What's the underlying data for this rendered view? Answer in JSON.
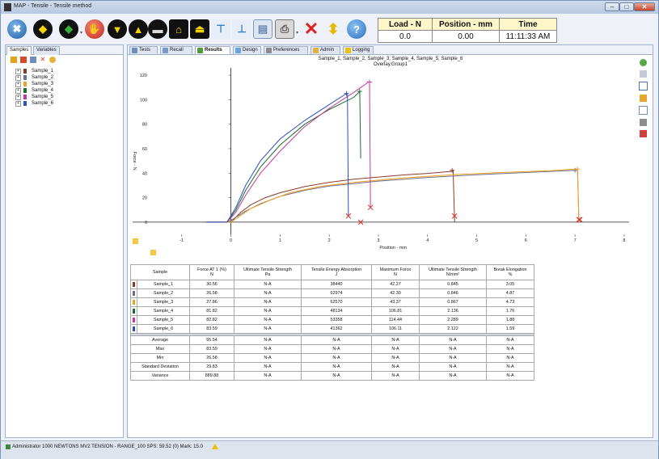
{
  "window": {
    "title": "MAP - Tensile - Tensile method"
  },
  "toolbar": {
    "icons": [
      "tools-icon",
      "sequence-up-icon",
      "sequence-down-icon",
      "stop-icon",
      "jog-down-icon",
      "jog-up-icon",
      "crosshead-icon",
      "home-icon",
      "return-icon",
      "clamp-icon",
      "fixture-icon",
      "report-icon",
      "print-icon",
      "delete-icon",
      "export-icon",
      "help-icon"
    ]
  },
  "readouts": {
    "load": {
      "label": "Load - N",
      "value": "0.0"
    },
    "position": {
      "label": "Position - mm",
      "value": "0.00"
    },
    "time": {
      "label": "Time",
      "value": "11:11:33 AM"
    }
  },
  "left_pane": {
    "tabs": [
      "Samples",
      "Variables"
    ],
    "samples": [
      {
        "name": "Sample_1",
        "color": "#8b3a2a"
      },
      {
        "name": "Sample_2",
        "color": "#6e6e8c"
      },
      {
        "name": "Sample_3",
        "color": "#f0a020"
      },
      {
        "name": "Sample_4",
        "color": "#1b6e2e"
      },
      {
        "name": "Sample_5",
        "color": "#c8389c"
      },
      {
        "name": "Sample_6",
        "color": "#2c4fc4"
      }
    ]
  },
  "main_tabs": [
    "Tests",
    "Recall",
    "Results",
    "Design",
    "Preferences",
    "Admin",
    "Logging"
  ],
  "chart_data": {
    "type": "line",
    "title": "Sample_1, Sample_2, Sample_3, Sample_4, Sample_5, Sample_6",
    "subtitle": "Overlay,Group1",
    "xlabel": "Position - mm",
    "ylabel": "Force - N",
    "xlim": [
      -2,
      8.1
    ],
    "ylim": [
      -10,
      126
    ],
    "xticks": [
      -1,
      0,
      1,
      2,
      3,
      4,
      5,
      6,
      7,
      8
    ],
    "yticks": [
      0,
      20,
      40,
      60,
      80,
      100,
      120
    ],
    "grid": false,
    "series": [
      {
        "name": "Sample_1",
        "color": "#8b3a2a",
        "x": [
          -0.55,
          -0.08,
          0.05,
          0.2,
          0.4,
          0.7,
          1.0,
          1.5,
          2.0,
          2.5,
          3.0,
          3.5,
          4.0,
          4.5,
          4.52,
          4.55
        ],
        "y": [
          0,
          0,
          2,
          8,
          14,
          20,
          24,
          29,
          32.5,
          35,
          36.8,
          38.5,
          39.8,
          41.5,
          42.27,
          0
        ],
        "max_marker": [
          4.5,
          42.27
        ],
        "break_marker": [
          4.55,
          5
        ]
      },
      {
        "name": "Sample_2",
        "color": "#6e6e8c",
        "x": [
          -0.55,
          -0.05,
          0.1,
          0.3,
          0.6,
          1.0,
          1.5,
          2.0,
          3.0,
          4.0,
          5.0,
          6.0,
          7.0,
          7.05,
          7.08
        ],
        "y": [
          0,
          0,
          4,
          9,
          15,
          21,
          26,
          29.5,
          33.5,
          36.5,
          38.7,
          40.5,
          42.3,
          42.3,
          0
        ],
        "max_marker": [
          7.0,
          42.3
        ],
        "break_marker": [
          7.1,
          2
        ]
      },
      {
        "name": "Sample_3",
        "color": "#f0a020",
        "x": [
          -0.5,
          0.0,
          0.15,
          0.4,
          0.8,
          1.2,
          1.8,
          2.5,
          3.5,
          4.5,
          5.5,
          6.5,
          7.0,
          7.05,
          7.08
        ],
        "y": [
          0,
          0,
          4,
          11,
          18,
          24,
          29,
          32.5,
          36,
          38.7,
          40.5,
          42,
          43.37,
          43.37,
          0
        ],
        "max_marker": [
          7.05,
          43.37
        ],
        "break_marker": [
          7.08,
          2
        ]
      },
      {
        "name": "Sample_4",
        "color": "#1b6e2e",
        "x": [
          -0.5,
          -0.08,
          0.1,
          0.3,
          0.6,
          1.0,
          1.5,
          2.0,
          2.5,
          2.62,
          2.64
        ],
        "y": [
          0,
          0,
          10,
          26,
          45,
          63,
          80,
          92,
          102,
          106.81,
          52
        ],
        "max_marker": [
          2.62,
          106.81
        ],
        "break_marker": [
          2.64,
          0
        ]
      },
      {
        "name": "Sample_5",
        "color": "#c8389c",
        "x": [
          -0.5,
          -0.08,
          0.1,
          0.3,
          0.6,
          1.0,
          1.5,
          2.0,
          2.5,
          2.8,
          2.82,
          2.84
        ],
        "y": [
          0,
          0,
          8,
          22,
          40,
          58,
          78,
          93,
          106,
          114.44,
          114.44,
          12
        ],
        "max_marker": [
          2.82,
          114.44
        ],
        "break_marker": [
          2.84,
          12
        ]
      },
      {
        "name": "Sample_6",
        "color": "#2c4fc4",
        "x": [
          -0.5,
          -0.08,
          0.1,
          0.3,
          0.6,
          1.0,
          1.5,
          2.0,
          2.35,
          2.37,
          2.39
        ],
        "y": [
          0,
          0,
          12,
          30,
          50,
          68,
          83,
          96,
          105,
          105.11,
          5
        ],
        "max_marker": [
          2.35,
          105.11
        ],
        "break_marker": [
          2.39,
          5
        ]
      }
    ]
  },
  "results_table": {
    "headers": [
      [
        "Sample",
        ""
      ],
      [
        "Force AT 1 (%)",
        "N"
      ],
      [
        "Ultimate Tensile Strength",
        "Pa"
      ],
      [
        "Tensile Energy Absorption",
        "J"
      ],
      [
        "Maximum Force",
        "N"
      ],
      [
        "Ultimate Tensile Strength",
        "N/mm²"
      ],
      [
        "Break Elongation",
        "%"
      ]
    ],
    "rows": [
      {
        "color": "#8b3a2a",
        "cells": [
          "Sample_1",
          "30.56",
          "N-A",
          "38440",
          "42.27",
          "0.845",
          "3.05"
        ]
      },
      {
        "color": "#6e6e8c",
        "cells": [
          "Sample_2",
          "26.58",
          "N-A",
          "62974",
          "42.30",
          "0.846",
          "4.87"
        ]
      },
      {
        "color": "#f0a020",
        "cells": [
          "Sample_3",
          "27.86",
          "N-A",
          "62570",
          "43.37",
          "0.867",
          "4.73"
        ]
      },
      {
        "color": "#1b6e2e",
        "cells": [
          "Sample_4",
          "81.82",
          "N-A",
          "48134",
          "106.81",
          "2.136",
          "1.76"
        ]
      },
      {
        "color": "#c8389c",
        "cells": [
          "Sample_5",
          "82.82",
          "N-A",
          "53358",
          "114.44",
          "2.289",
          "1.88"
        ]
      },
      {
        "color": "#2c4fc4",
        "cells": [
          "Sample_6",
          "83.59",
          "N-A",
          "41362",
          "106.11",
          "2.122",
          "1.59"
        ]
      }
    ],
    "stats": [
      [
        "Average",
        "55.54",
        "N-A",
        "N-A",
        "N-A",
        "N-A",
        "N-A"
      ],
      [
        "Max",
        "83.59",
        "N-A",
        "N-A",
        "N-A",
        "N-A",
        "N-A"
      ],
      [
        "Min",
        "26.58",
        "N-A",
        "N-A",
        "N-A",
        "N-A",
        "N-A"
      ],
      [
        "Standard Deviation",
        "29.83",
        "N-A",
        "N-A",
        "N-A",
        "N-A",
        "N-A"
      ],
      [
        "Variance",
        "889.88",
        "N-A",
        "N-A",
        "N-A",
        "N-A",
        "N-A"
      ]
    ]
  },
  "statusbar": {
    "text": "Administrator  1000 NEWTONS MV2 TENSION - RANGE_100  SPS: 59.52 (0)  Mark: 15.0"
  }
}
